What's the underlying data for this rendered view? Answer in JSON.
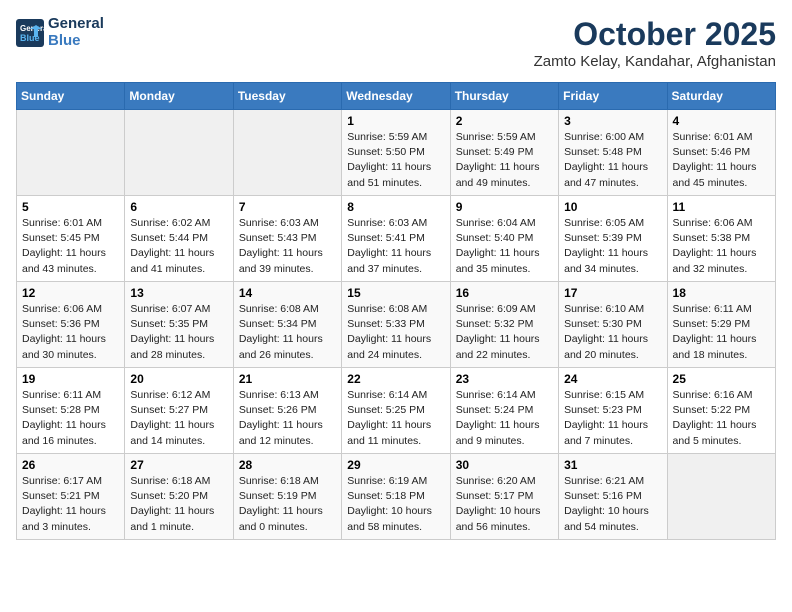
{
  "logo": {
    "line1": "General",
    "line2": "Blue"
  },
  "title": "October 2025",
  "subtitle": "Zamto Kelay, Kandahar, Afghanistan",
  "weekdays": [
    "Sunday",
    "Monday",
    "Tuesday",
    "Wednesday",
    "Thursday",
    "Friday",
    "Saturday"
  ],
  "weeks": [
    [
      {
        "day": "",
        "detail": ""
      },
      {
        "day": "",
        "detail": ""
      },
      {
        "day": "",
        "detail": ""
      },
      {
        "day": "1",
        "detail": "Sunrise: 5:59 AM\nSunset: 5:50 PM\nDaylight: 11 hours\nand 51 minutes."
      },
      {
        "day": "2",
        "detail": "Sunrise: 5:59 AM\nSunset: 5:49 PM\nDaylight: 11 hours\nand 49 minutes."
      },
      {
        "day": "3",
        "detail": "Sunrise: 6:00 AM\nSunset: 5:48 PM\nDaylight: 11 hours\nand 47 minutes."
      },
      {
        "day": "4",
        "detail": "Sunrise: 6:01 AM\nSunset: 5:46 PM\nDaylight: 11 hours\nand 45 minutes."
      }
    ],
    [
      {
        "day": "5",
        "detail": "Sunrise: 6:01 AM\nSunset: 5:45 PM\nDaylight: 11 hours\nand 43 minutes."
      },
      {
        "day": "6",
        "detail": "Sunrise: 6:02 AM\nSunset: 5:44 PM\nDaylight: 11 hours\nand 41 minutes."
      },
      {
        "day": "7",
        "detail": "Sunrise: 6:03 AM\nSunset: 5:43 PM\nDaylight: 11 hours\nand 39 minutes."
      },
      {
        "day": "8",
        "detail": "Sunrise: 6:03 AM\nSunset: 5:41 PM\nDaylight: 11 hours\nand 37 minutes."
      },
      {
        "day": "9",
        "detail": "Sunrise: 6:04 AM\nSunset: 5:40 PM\nDaylight: 11 hours\nand 35 minutes."
      },
      {
        "day": "10",
        "detail": "Sunrise: 6:05 AM\nSunset: 5:39 PM\nDaylight: 11 hours\nand 34 minutes."
      },
      {
        "day": "11",
        "detail": "Sunrise: 6:06 AM\nSunset: 5:38 PM\nDaylight: 11 hours\nand 32 minutes."
      }
    ],
    [
      {
        "day": "12",
        "detail": "Sunrise: 6:06 AM\nSunset: 5:36 PM\nDaylight: 11 hours\nand 30 minutes."
      },
      {
        "day": "13",
        "detail": "Sunrise: 6:07 AM\nSunset: 5:35 PM\nDaylight: 11 hours\nand 28 minutes."
      },
      {
        "day": "14",
        "detail": "Sunrise: 6:08 AM\nSunset: 5:34 PM\nDaylight: 11 hours\nand 26 minutes."
      },
      {
        "day": "15",
        "detail": "Sunrise: 6:08 AM\nSunset: 5:33 PM\nDaylight: 11 hours\nand 24 minutes."
      },
      {
        "day": "16",
        "detail": "Sunrise: 6:09 AM\nSunset: 5:32 PM\nDaylight: 11 hours\nand 22 minutes."
      },
      {
        "day": "17",
        "detail": "Sunrise: 6:10 AM\nSunset: 5:30 PM\nDaylight: 11 hours\nand 20 minutes."
      },
      {
        "day": "18",
        "detail": "Sunrise: 6:11 AM\nSunset: 5:29 PM\nDaylight: 11 hours\nand 18 minutes."
      }
    ],
    [
      {
        "day": "19",
        "detail": "Sunrise: 6:11 AM\nSunset: 5:28 PM\nDaylight: 11 hours\nand 16 minutes."
      },
      {
        "day": "20",
        "detail": "Sunrise: 6:12 AM\nSunset: 5:27 PM\nDaylight: 11 hours\nand 14 minutes."
      },
      {
        "day": "21",
        "detail": "Sunrise: 6:13 AM\nSunset: 5:26 PM\nDaylight: 11 hours\nand 12 minutes."
      },
      {
        "day": "22",
        "detail": "Sunrise: 6:14 AM\nSunset: 5:25 PM\nDaylight: 11 hours\nand 11 minutes."
      },
      {
        "day": "23",
        "detail": "Sunrise: 6:14 AM\nSunset: 5:24 PM\nDaylight: 11 hours\nand 9 minutes."
      },
      {
        "day": "24",
        "detail": "Sunrise: 6:15 AM\nSunset: 5:23 PM\nDaylight: 11 hours\nand 7 minutes."
      },
      {
        "day": "25",
        "detail": "Sunrise: 6:16 AM\nSunset: 5:22 PM\nDaylight: 11 hours\nand 5 minutes."
      }
    ],
    [
      {
        "day": "26",
        "detail": "Sunrise: 6:17 AM\nSunset: 5:21 PM\nDaylight: 11 hours\nand 3 minutes."
      },
      {
        "day": "27",
        "detail": "Sunrise: 6:18 AM\nSunset: 5:20 PM\nDaylight: 11 hours\nand 1 minute."
      },
      {
        "day": "28",
        "detail": "Sunrise: 6:18 AM\nSunset: 5:19 PM\nDaylight: 11 hours\nand 0 minutes."
      },
      {
        "day": "29",
        "detail": "Sunrise: 6:19 AM\nSunset: 5:18 PM\nDaylight: 10 hours\nand 58 minutes."
      },
      {
        "day": "30",
        "detail": "Sunrise: 6:20 AM\nSunset: 5:17 PM\nDaylight: 10 hours\nand 56 minutes."
      },
      {
        "day": "31",
        "detail": "Sunrise: 6:21 AM\nSunset: 5:16 PM\nDaylight: 10 hours\nand 54 minutes."
      },
      {
        "day": "",
        "detail": ""
      }
    ]
  ]
}
